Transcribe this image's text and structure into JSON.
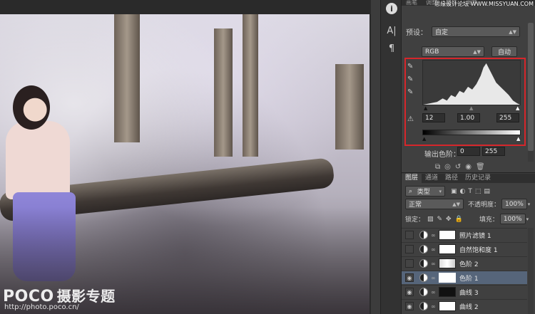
{
  "canvas": {
    "watermark_brand": "POCO",
    "watermark_cn": "摄影专题",
    "watermark_url": "http://photo.poco.cn/"
  },
  "tools": {
    "info_icon": "i",
    "char_icon": "A|",
    "para_icon": "¶"
  },
  "properties": {
    "tabs": [
      "画笔",
      "调整",
      "属性",
      "调节"
    ],
    "site_watermark": "思缘设计论坛 WWW.MISSYUAN.COM",
    "preset_label": "预设：",
    "preset_value": "自定",
    "channel_value": "RGB",
    "auto_button": "自动",
    "input_black": "12",
    "input_gamma": "1.00",
    "input_white": "255",
    "output_label": "输出色阶：",
    "output_black": "0",
    "output_white": "255"
  },
  "layers": {
    "tabs": [
      "图层",
      "通道",
      "路径",
      "历史记录"
    ],
    "filter_kind": "类型",
    "blend_mode": "正常",
    "opacity_label": "不透明度：",
    "opacity_value": "100%",
    "lock_label": "锁定：",
    "fill_label": "填充：",
    "fill_value": "100%",
    "items": [
      {
        "name": "照片滤镜 1",
        "visible": false
      },
      {
        "name": "自然饱和度 1",
        "visible": false
      },
      {
        "name": "色阶 2",
        "visible": false
      },
      {
        "name": "色阶 1",
        "visible": true,
        "selected": true
      },
      {
        "name": "曲线 3",
        "visible": true
      },
      {
        "name": "曲线 2",
        "visible": true
      }
    ]
  }
}
